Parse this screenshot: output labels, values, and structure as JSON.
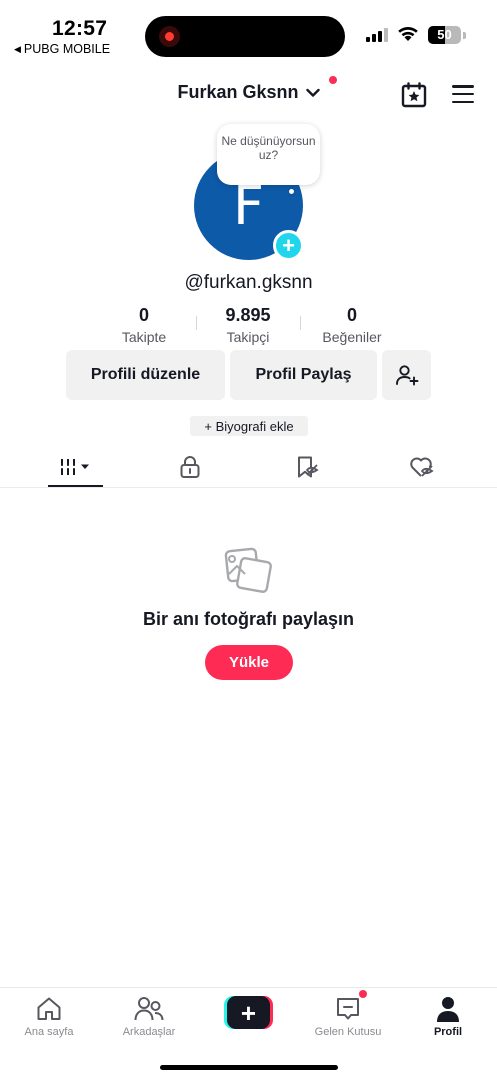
{
  "status_bar": {
    "time": "12:57",
    "back_app": "PUBG MOBILE",
    "battery": "50",
    "battery_level": 0.5
  },
  "header": {
    "username": "Furkan Gksnn",
    "calendar_icon": "calendar-star-icon",
    "menu_icon": "hamburger-menu-icon"
  },
  "profile": {
    "avatar_letter": "F",
    "avatar_color": "#0d5aa8",
    "thought_bubble": "Ne düşünüyorsun uz?",
    "handle": "@furkan.gksnn",
    "stats": [
      {
        "value": "0",
        "label": "Takipte"
      },
      {
        "value": "9.895",
        "label": "Takipçi"
      },
      {
        "value": "0",
        "label": "Beğeniler"
      }
    ],
    "edit_button": "Profili düzenle",
    "share_button": "Profil Paylaş",
    "bio_chip": "+ Biyografi ekle"
  },
  "tabs": [
    {
      "icon": "grid-videos-icon",
      "active": true
    },
    {
      "icon": "lock-icon",
      "active": false
    },
    {
      "icon": "bookmark-icon",
      "active": false
    },
    {
      "icon": "liked-heart-icon",
      "active": false
    }
  ],
  "empty_state": {
    "title": "Bir anı fotoğrafı paylaşın",
    "button": "Yükle"
  },
  "bottom_nav": [
    {
      "label": "Ana sayfa",
      "icon": "home-icon"
    },
    {
      "label": "Arkadaşlar",
      "icon": "friends-icon"
    },
    {
      "label": "",
      "icon": "create-plus-icon"
    },
    {
      "label": "Gelen Kutusu",
      "icon": "inbox-icon"
    },
    {
      "label": "Profil",
      "icon": "profile-icon"
    }
  ],
  "colors": {
    "accent": "#fe2c55",
    "cyan": "#20d5ec",
    "text": "#161823"
  }
}
